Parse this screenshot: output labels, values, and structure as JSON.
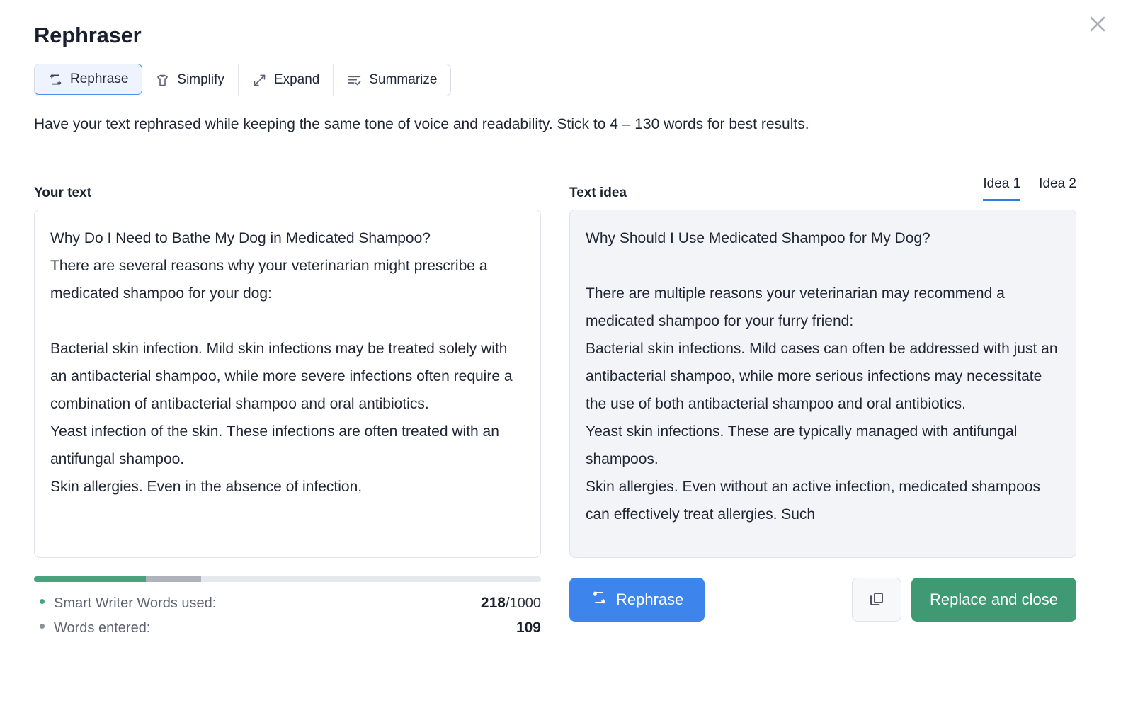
{
  "window": {
    "title": "Rephraser",
    "close_icon": "close-icon"
  },
  "modes": {
    "tabs": [
      {
        "label": "Rephrase",
        "icon": "rephrase-icon",
        "active": true
      },
      {
        "label": "Simplify",
        "icon": "tshirt-icon",
        "active": false
      },
      {
        "label": "Expand",
        "icon": "expand-arrows-icon",
        "active": false
      },
      {
        "label": "Summarize",
        "icon": "summarize-list-check-icon",
        "active": false
      }
    ]
  },
  "description": "Have your text rephrased while keeping the same tone of voice and readability. Stick to 4 – 130 words for best results.",
  "source": {
    "label": "Your text",
    "content": "Why Do I Need to Bathe My Dog in Medicated Shampoo?\nThere are several reasons why your veterinarian might prescribe a medicated shampoo for your dog:\n\nBacterial skin infection. Mild skin infections may be treated solely with an antibacterial shampoo, while more severe infections often require a combination of antibacterial shampoo and oral antibiotics.\nYeast infection of the skin. These infections are often treated with an antifungal shampoo.\nSkin allergies. Even in the absence of infection,"
  },
  "idea": {
    "label": "Text idea",
    "tabs": [
      {
        "label": "Idea 1",
        "active": true
      },
      {
        "label": "Idea 2",
        "active": false
      }
    ],
    "content": "Why Should I Use Medicated Shampoo for My Dog?\n\nThere are multiple reasons your veterinarian may recommend a medicated shampoo for your furry friend:\nBacterial skin infections. Mild cases can often be addressed with just an antibacterial shampoo, while more serious infections may necessitate the use of both antibacterial shampoo and oral antibiotics.\nYeast skin infections. These are typically managed with antifungal shampoos.\nSkin allergies. Even without an active infection, medicated shampoos can effectively treat allergies. Such"
  },
  "usage": {
    "progress": {
      "green_percent": 22,
      "gray_percent": 11
    },
    "rows": [
      {
        "label": "Smart Writer Words used:",
        "value_main": "218",
        "value_suffix": "/1000",
        "bullet_color": "#4aa27c"
      },
      {
        "label": "Words entered:",
        "value_main": "109",
        "value_suffix": "",
        "bullet_color": "#8b909b"
      }
    ]
  },
  "actions": {
    "rephrase_label": "Rephrase",
    "rephrase_icon": "rephrase-icon",
    "copy_icon": "copy-icon",
    "replace_label": "Replace and close"
  },
  "colors": {
    "accent_blue": "#3d85ec",
    "accent_green": "#3f9a74",
    "tab_active_bg": "#eef3fd",
    "tab_active_border": "#4a8df0",
    "idea_panel_bg": "#f2f4f8",
    "progress_green": "#4aa27c",
    "progress_gray": "#adb2bb",
    "progress_track": "#e6e8ee"
  }
}
